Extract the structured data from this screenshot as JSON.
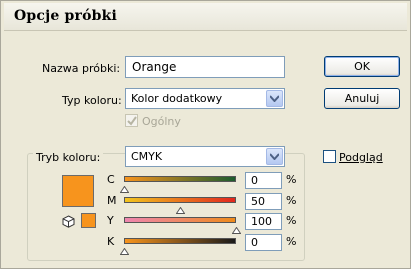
{
  "window": {
    "title": "Opcje próbki"
  },
  "swatch_name": {
    "label": "Nazwa próbki:",
    "value": "Orange"
  },
  "color_type": {
    "label": "Typ koloru:",
    "value": "Kolor dodatkowy"
  },
  "global": {
    "label": "Ogólny",
    "checked": true,
    "disabled": true
  },
  "buttons": {
    "ok": "OK",
    "cancel": "Anuluj"
  },
  "preview": {
    "label": "Podgląd",
    "checked": false
  },
  "color_mode": {
    "label": "Tryb koloru:",
    "value": "CMYK"
  },
  "swatch_color": "#f7941d",
  "channels": [
    {
      "name": "C",
      "value": "0",
      "unit": "%",
      "level": 0.0,
      "gradient_from": "#f7941d",
      "gradient_to": "#1d5c2e"
    },
    {
      "name": "M",
      "value": "50",
      "unit": "%",
      "level": 0.5,
      "gradient_from": "#f2c41d",
      "gradient_to": "#e2271d"
    },
    {
      "name": "Y",
      "value": "100",
      "unit": "%",
      "level": 1.0,
      "gradient_from": "#ee86b0",
      "gradient_to": "#ee8a1a"
    },
    {
      "name": "K",
      "value": "0",
      "unit": "%",
      "level": 0.0,
      "gradient_from": "#f7941d",
      "gradient_to": "#1a1a1a"
    }
  ]
}
